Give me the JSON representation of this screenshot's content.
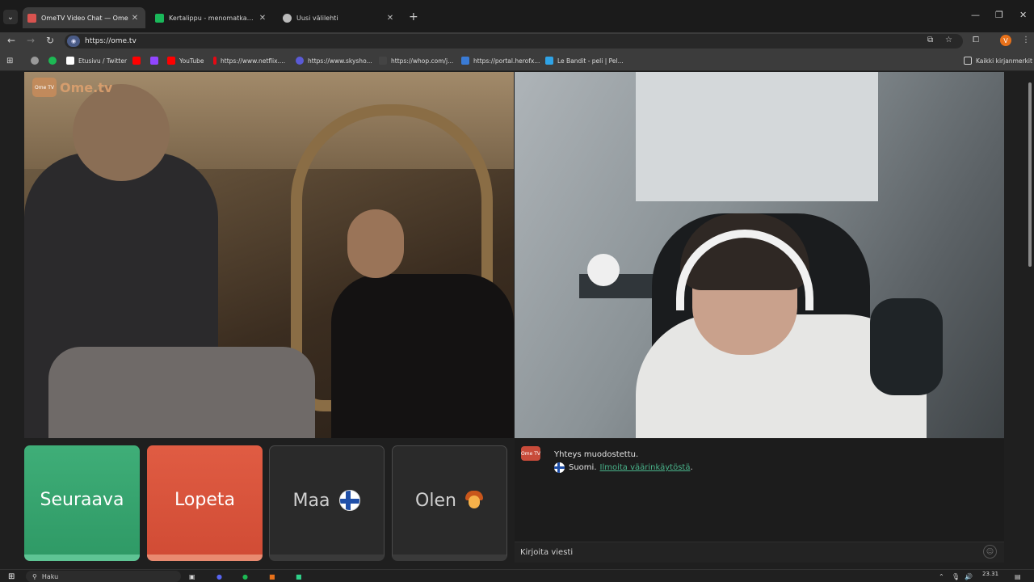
{
  "browser": {
    "tabs": [
      {
        "title": "OmeTV Video Chat — Ome",
        "active": true,
        "favicon_color": "#d9534f"
      },
      {
        "title": "Kertalippu - menomatkan tiedo",
        "active": false,
        "favicon_color": "#1ab85a"
      },
      {
        "title": "Uusi välilehti",
        "active": false,
        "favicon_color": "#bbbbbb"
      }
    ],
    "new_tab_label": "+",
    "url": "https://ome.tv",
    "profile_initial": "V",
    "bookmarks": [
      {
        "label": "Etusivu / Twitter",
        "color": "#ffffff"
      },
      {
        "label": "YouTube",
        "color": "#ff0000"
      },
      {
        "label": "https://www.netflix....",
        "color": "#e50914"
      },
      {
        "label": "https://www.skysho...",
        "color": "#5a5ad6"
      },
      {
        "label": "https://whop.com/j...",
        "color": "#ff6243"
      },
      {
        "label": "https://portal.herofx...",
        "color": "#3a7bd5"
      },
      {
        "label": "Le Bandit - peli | Pel...",
        "color": "#2fa3e6"
      }
    ],
    "all_bookmarks_label": "Kaikki kirjanmerkit"
  },
  "app": {
    "logo_text": "Ome.tv",
    "logo_badge": "Ome TV",
    "buttons": {
      "next": "Seuraava",
      "stop": "Lopeta",
      "country": "Maa",
      "gender": "Olen"
    },
    "chat": {
      "badge": "Ome TV",
      "status": "Yhteys muodostettu.",
      "country": "Suomi.",
      "report_link": "Ilmoita väärinkäytöstä",
      "report_suffix": ".",
      "input_placeholder": "Kirjoita viesti"
    }
  },
  "taskbar": {
    "search_placeholder": "Haku",
    "time": "23.31",
    "date": "1.2.2024"
  },
  "colors": {
    "next_button": "#37a36f",
    "stop_button": "#d9553c",
    "link": "#49b38a"
  }
}
